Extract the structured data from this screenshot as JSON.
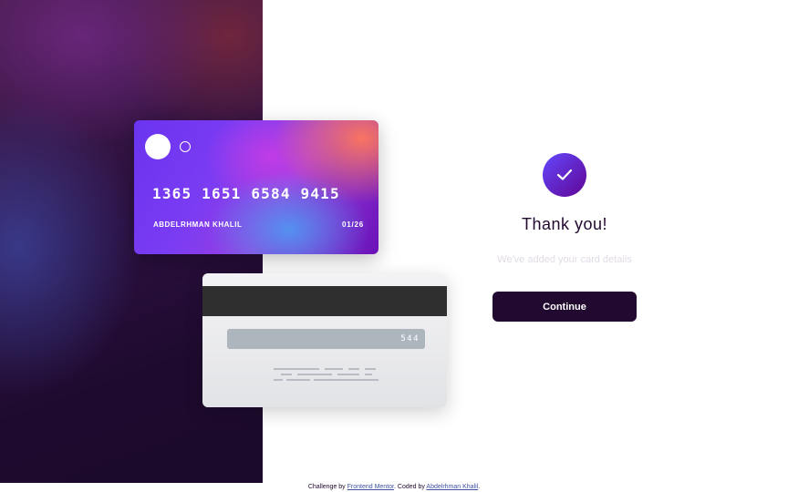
{
  "card": {
    "number": "1365 1651 6584 9415",
    "holder": "ABDELRHMAN KHALIL",
    "expiry": "01/26",
    "cvc": "544"
  },
  "complete": {
    "title": "Thank you!",
    "subtitle": "We've added your card details",
    "continue_label": "Continue",
    "icon": "check-icon"
  },
  "attribution": {
    "prefix": "Challenge by ",
    "fm_link": "Frontend Mentor",
    "middle": ". Coded by ",
    "author_link": "Abdelrhman Khalil",
    "suffix": "."
  },
  "colors": {
    "dark_violet": "#21092f",
    "accent_start": "#6448fe",
    "accent_end": "#600594",
    "cvc_box": "#adb5bd"
  }
}
